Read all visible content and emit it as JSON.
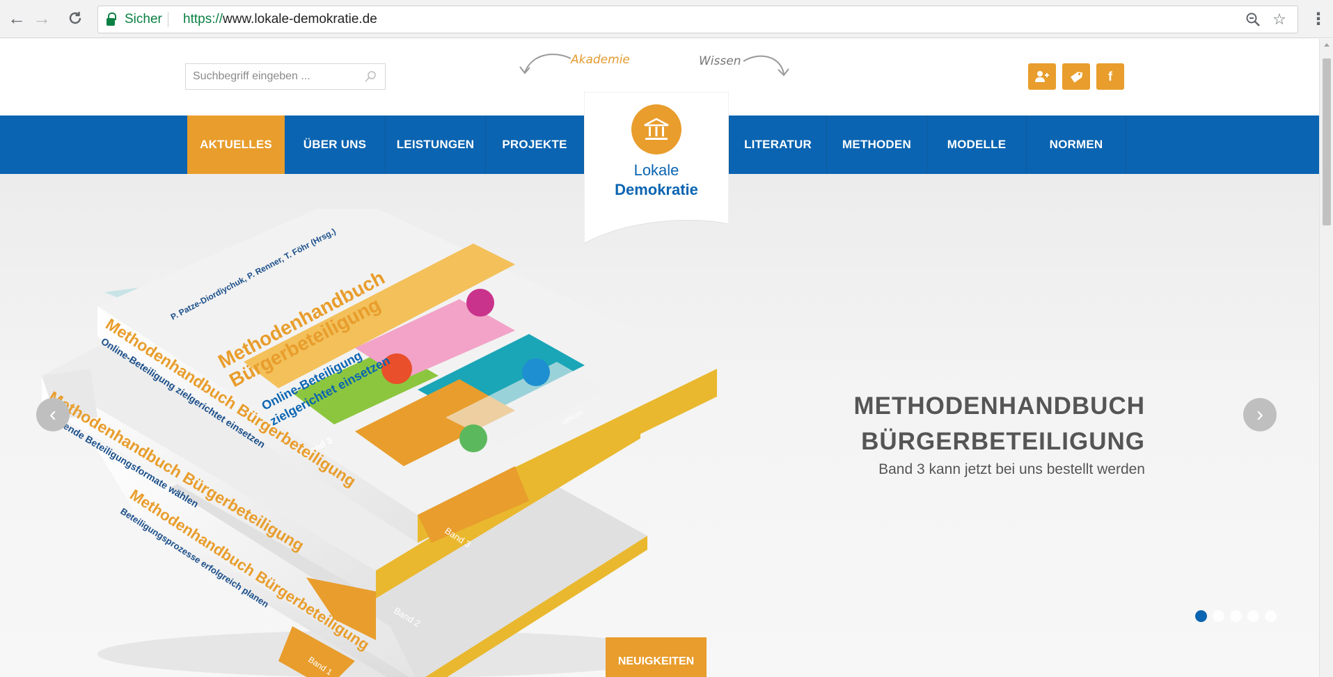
{
  "browser": {
    "secure_label": "Sicher",
    "url_scheme": "https://",
    "url_rest": "www.lokale-demokratie.de",
    "icons": {
      "back": "back-arrow-icon",
      "forward": "forward-arrow-icon",
      "reload": "reload-icon",
      "zoom": "zoom-icon",
      "bookmark": "star-icon",
      "menu": "kebab-menu-icon"
    }
  },
  "header": {
    "search_placeholder": "Suchbegriff eingeben ...",
    "link_akademie": "Akademie",
    "link_wissen": "Wissen",
    "social": {
      "facebook": "f"
    }
  },
  "nav": {
    "items_left": [
      "AKTUELLES",
      "ÜBER UNS",
      "LEISTUNGEN",
      "PROJEKTE"
    ],
    "items_right": [
      "LITERATUR",
      "METHODEN",
      "MODELLE",
      "NORMEN"
    ],
    "active": "AKTUELLES"
  },
  "logo": {
    "line1": "Lokale",
    "line2": "Demokratie"
  },
  "slide": {
    "title_line1": "METHODENHANDBUCH",
    "title_line2": "BÜRGERBETEILIGUNG",
    "subtitle": "Band 3 kann jetzt bei uns bestellt werden",
    "dot_count": 5,
    "active_dot": 0,
    "book_top_author": "P. Patze-Diordiychuk,\nP. Renner, T. Föhr (Hrsg.)",
    "book_top_title1": "Methodenhandbuch",
    "book_top_title2": "Bürgerbeteiligung",
    "book_top_sub1": "Online-Beteiligung",
    "book_top_sub2": "zielgerichtet einsetzen",
    "book_band3": "Band 3",
    "spine3_title": "Methodenhandbuch Bürgerbeteiligung",
    "spine3_sub": "Online-Beteiligung zielgerichtet einsetzen",
    "spine2_title": "Methodenhandbuch Bürgerbeteiligung",
    "spine2_sub": "Passende Beteiligungsformate wählen",
    "spine1_title": "Methodenhandbuch Bürgerbeteiligung",
    "spine1_sub": "Beteiligungsprozesse erfolgreich planen",
    "band2": "Band 2",
    "band1": "Band 1",
    "publisher": "oekom"
  },
  "news_tab": "NEUIGKEITEN",
  "colors": {
    "brand_blue": "#0a64b1",
    "brand_orange": "#e89d2c",
    "secure_green": "#0b8043"
  }
}
